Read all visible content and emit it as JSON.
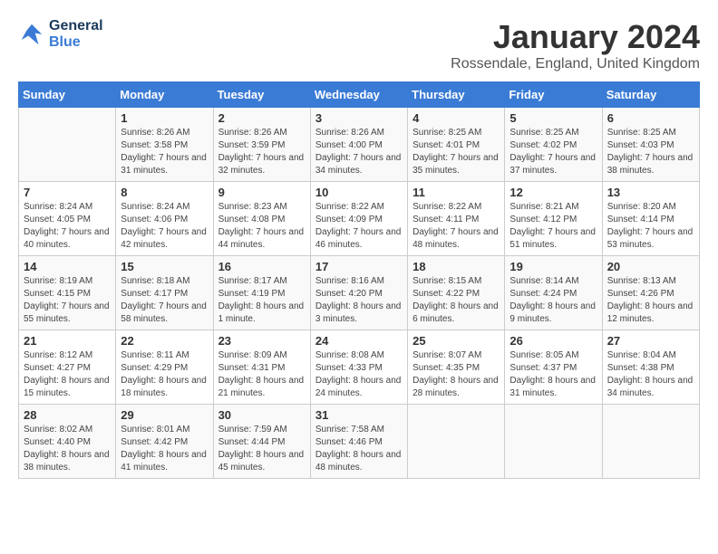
{
  "header": {
    "logo_line1": "General",
    "logo_line2": "Blue",
    "month_title": "January 2024",
    "location": "Rossendale, England, United Kingdom"
  },
  "days_of_week": [
    "Sunday",
    "Monday",
    "Tuesday",
    "Wednesday",
    "Thursday",
    "Friday",
    "Saturday"
  ],
  "weeks": [
    [
      {
        "day": "",
        "sunrise": "",
        "sunset": "",
        "daylight": ""
      },
      {
        "day": "1",
        "sunrise": "Sunrise: 8:26 AM",
        "sunset": "Sunset: 3:58 PM",
        "daylight": "Daylight: 7 hours and 31 minutes."
      },
      {
        "day": "2",
        "sunrise": "Sunrise: 8:26 AM",
        "sunset": "Sunset: 3:59 PM",
        "daylight": "Daylight: 7 hours and 32 minutes."
      },
      {
        "day": "3",
        "sunrise": "Sunrise: 8:26 AM",
        "sunset": "Sunset: 4:00 PM",
        "daylight": "Daylight: 7 hours and 34 minutes."
      },
      {
        "day": "4",
        "sunrise": "Sunrise: 8:25 AM",
        "sunset": "Sunset: 4:01 PM",
        "daylight": "Daylight: 7 hours and 35 minutes."
      },
      {
        "day": "5",
        "sunrise": "Sunrise: 8:25 AM",
        "sunset": "Sunset: 4:02 PM",
        "daylight": "Daylight: 7 hours and 37 minutes."
      },
      {
        "day": "6",
        "sunrise": "Sunrise: 8:25 AM",
        "sunset": "Sunset: 4:03 PM",
        "daylight": "Daylight: 7 hours and 38 minutes."
      }
    ],
    [
      {
        "day": "7",
        "sunrise": "Sunrise: 8:24 AM",
        "sunset": "Sunset: 4:05 PM",
        "daylight": "Daylight: 7 hours and 40 minutes."
      },
      {
        "day": "8",
        "sunrise": "Sunrise: 8:24 AM",
        "sunset": "Sunset: 4:06 PM",
        "daylight": "Daylight: 7 hours and 42 minutes."
      },
      {
        "day": "9",
        "sunrise": "Sunrise: 8:23 AM",
        "sunset": "Sunset: 4:08 PM",
        "daylight": "Daylight: 7 hours and 44 minutes."
      },
      {
        "day": "10",
        "sunrise": "Sunrise: 8:22 AM",
        "sunset": "Sunset: 4:09 PM",
        "daylight": "Daylight: 7 hours and 46 minutes."
      },
      {
        "day": "11",
        "sunrise": "Sunrise: 8:22 AM",
        "sunset": "Sunset: 4:11 PM",
        "daylight": "Daylight: 7 hours and 48 minutes."
      },
      {
        "day": "12",
        "sunrise": "Sunrise: 8:21 AM",
        "sunset": "Sunset: 4:12 PM",
        "daylight": "Daylight: 7 hours and 51 minutes."
      },
      {
        "day": "13",
        "sunrise": "Sunrise: 8:20 AM",
        "sunset": "Sunset: 4:14 PM",
        "daylight": "Daylight: 7 hours and 53 minutes."
      }
    ],
    [
      {
        "day": "14",
        "sunrise": "Sunrise: 8:19 AM",
        "sunset": "Sunset: 4:15 PM",
        "daylight": "Daylight: 7 hours and 55 minutes."
      },
      {
        "day": "15",
        "sunrise": "Sunrise: 8:18 AM",
        "sunset": "Sunset: 4:17 PM",
        "daylight": "Daylight: 7 hours and 58 minutes."
      },
      {
        "day": "16",
        "sunrise": "Sunrise: 8:17 AM",
        "sunset": "Sunset: 4:19 PM",
        "daylight": "Daylight: 8 hours and 1 minute."
      },
      {
        "day": "17",
        "sunrise": "Sunrise: 8:16 AM",
        "sunset": "Sunset: 4:20 PM",
        "daylight": "Daylight: 8 hours and 3 minutes."
      },
      {
        "day": "18",
        "sunrise": "Sunrise: 8:15 AM",
        "sunset": "Sunset: 4:22 PM",
        "daylight": "Daylight: 8 hours and 6 minutes."
      },
      {
        "day": "19",
        "sunrise": "Sunrise: 8:14 AM",
        "sunset": "Sunset: 4:24 PM",
        "daylight": "Daylight: 8 hours and 9 minutes."
      },
      {
        "day": "20",
        "sunrise": "Sunrise: 8:13 AM",
        "sunset": "Sunset: 4:26 PM",
        "daylight": "Daylight: 8 hours and 12 minutes."
      }
    ],
    [
      {
        "day": "21",
        "sunrise": "Sunrise: 8:12 AM",
        "sunset": "Sunset: 4:27 PM",
        "daylight": "Daylight: 8 hours and 15 minutes."
      },
      {
        "day": "22",
        "sunrise": "Sunrise: 8:11 AM",
        "sunset": "Sunset: 4:29 PM",
        "daylight": "Daylight: 8 hours and 18 minutes."
      },
      {
        "day": "23",
        "sunrise": "Sunrise: 8:09 AM",
        "sunset": "Sunset: 4:31 PM",
        "daylight": "Daylight: 8 hours and 21 minutes."
      },
      {
        "day": "24",
        "sunrise": "Sunrise: 8:08 AM",
        "sunset": "Sunset: 4:33 PM",
        "daylight": "Daylight: 8 hours and 24 minutes."
      },
      {
        "day": "25",
        "sunrise": "Sunrise: 8:07 AM",
        "sunset": "Sunset: 4:35 PM",
        "daylight": "Daylight: 8 hours and 28 minutes."
      },
      {
        "day": "26",
        "sunrise": "Sunrise: 8:05 AM",
        "sunset": "Sunset: 4:37 PM",
        "daylight": "Daylight: 8 hours and 31 minutes."
      },
      {
        "day": "27",
        "sunrise": "Sunrise: 8:04 AM",
        "sunset": "Sunset: 4:38 PM",
        "daylight": "Daylight: 8 hours and 34 minutes."
      }
    ],
    [
      {
        "day": "28",
        "sunrise": "Sunrise: 8:02 AM",
        "sunset": "Sunset: 4:40 PM",
        "daylight": "Daylight: 8 hours and 38 minutes."
      },
      {
        "day": "29",
        "sunrise": "Sunrise: 8:01 AM",
        "sunset": "Sunset: 4:42 PM",
        "daylight": "Daylight: 8 hours and 41 minutes."
      },
      {
        "day": "30",
        "sunrise": "Sunrise: 7:59 AM",
        "sunset": "Sunset: 4:44 PM",
        "daylight": "Daylight: 8 hours and 45 minutes."
      },
      {
        "day": "31",
        "sunrise": "Sunrise: 7:58 AM",
        "sunset": "Sunset: 4:46 PM",
        "daylight": "Daylight: 8 hours and 48 minutes."
      },
      {
        "day": "",
        "sunrise": "",
        "sunset": "",
        "daylight": ""
      },
      {
        "day": "",
        "sunrise": "",
        "sunset": "",
        "daylight": ""
      },
      {
        "day": "",
        "sunrise": "",
        "sunset": "",
        "daylight": ""
      }
    ]
  ]
}
